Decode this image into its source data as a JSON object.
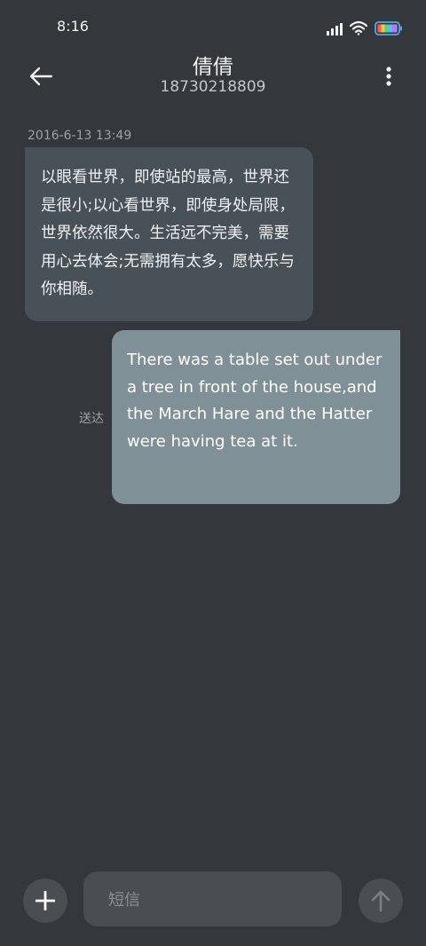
{
  "status_bar": {
    "time": "8:16",
    "signal_icon": "signal-icon",
    "wifi_icon": "wifi-icon",
    "battery_icon": "battery-icon"
  },
  "header": {
    "contact_name": "倩倩",
    "contact_number": "18730218809",
    "back_icon": "back-arrow-icon",
    "more_icon": "more-vertical-icon"
  },
  "conversation": {
    "timestamp": "2016-6-13 13:49",
    "messages": [
      {
        "direction": "incoming",
        "text": "以眼看世界，即使站的最高，世界还是很小;以心看世界，即使身处局限，世界依然很大。生活远不完美，需要用心去体会;无需拥有太多，愿快乐与你相随。"
      },
      {
        "direction": "outgoing",
        "text": "There was a table set out under a tree in front of the house,and the March Hare and the Hatter were having tea at it.",
        "status": "送达"
      }
    ]
  },
  "composer": {
    "placeholder": "短信",
    "add_icon": "plus-icon",
    "send_icon": "send-arrow-icon"
  },
  "colors": {
    "background": "#34373b",
    "incoming_bubble": "#485158",
    "outgoing_bubble": "#7f9096",
    "control": "#4a4e53"
  }
}
